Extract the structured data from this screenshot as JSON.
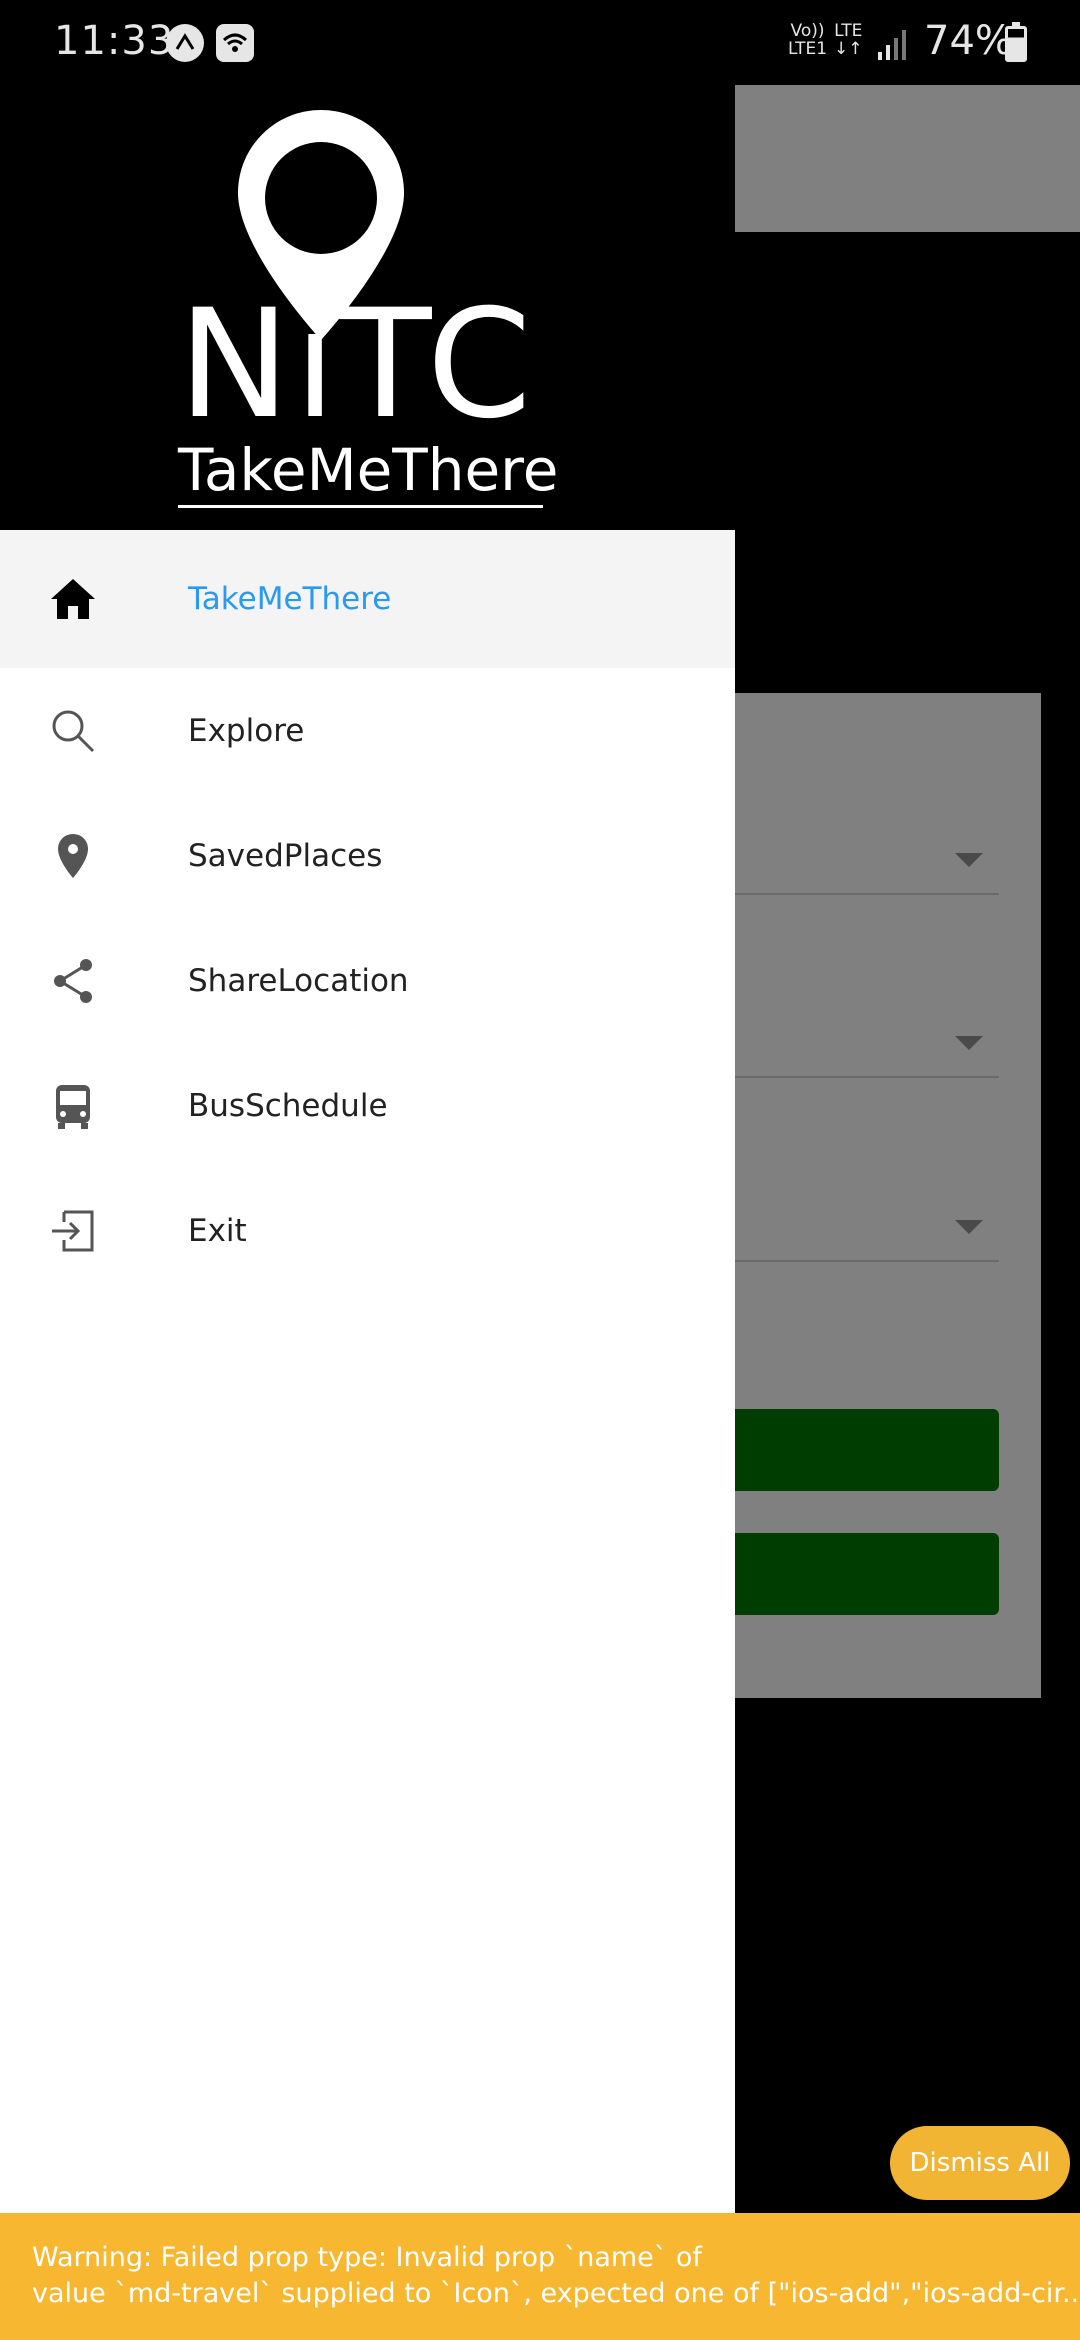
{
  "status_bar": {
    "time": "11:33",
    "network": "Vo))\nLTE1",
    "lte": "LTE",
    "battery": "74%"
  },
  "drawer": {
    "logo_title": "NiTC",
    "logo_subtitle": "TakeMeThere",
    "items": [
      {
        "label": "TakeMeThere",
        "icon": "home-icon",
        "active": true
      },
      {
        "label": "Explore",
        "icon": "search-icon",
        "active": false
      },
      {
        "label": "SavedPlaces",
        "icon": "location-pin-icon",
        "active": false
      },
      {
        "label": "ShareLocation",
        "icon": "share-icon",
        "active": false
      },
      {
        "label": "BusSchedule",
        "icon": "bus-icon",
        "active": false
      },
      {
        "label": "Exit",
        "icon": "exit-icon",
        "active": false
      }
    ]
  },
  "toast": {
    "dismiss_label": "Dismiss All",
    "warning_line1": "Warning: Failed prop type: Invalid prop `name` of",
    "warning_line2": "value `md-travel` supplied to `Icon`, expected one of [\"ios-add\",\"ios-add-cir..."
  },
  "colors": {
    "accent": "#2a9af0",
    "warning_bg": "#f7b731",
    "button_green": "#003d00"
  }
}
